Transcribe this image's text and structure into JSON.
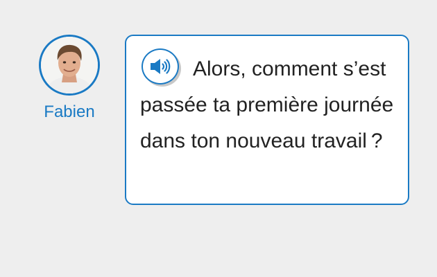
{
  "speaker": {
    "name": "Fabien",
    "avatar_icon": "person-avatar"
  },
  "message": {
    "text": "Alors, comment s’est passée ta première journée dans ton nouveau travail ?",
    "audio_icon": "speaker-icon"
  },
  "colors": {
    "accent": "#1a7ac4",
    "background": "#eeeeee",
    "bubble": "#ffffff",
    "text": "#222222"
  }
}
